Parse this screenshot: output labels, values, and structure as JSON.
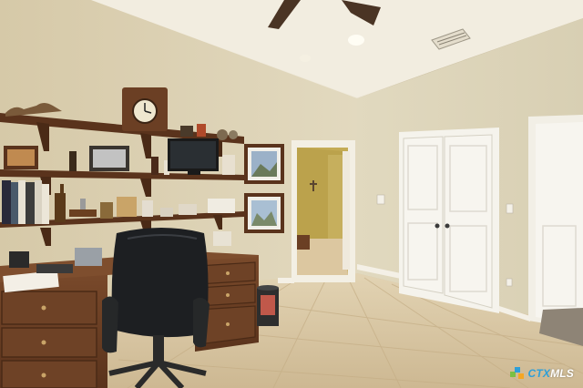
{
  "scene": {
    "description_room": "home-office",
    "colors": {
      "wall": "#ddd3b6",
      "ceiling": "#efeadd",
      "floor": "#d9c7a3",
      "wood": "#6b3f24",
      "door": "#f7f5ef",
      "hallway": "#c9b25a"
    }
  },
  "watermark": {
    "part1": "CTX",
    "part2": "MLS",
    "icon": "ctxmls-logo-icon"
  }
}
